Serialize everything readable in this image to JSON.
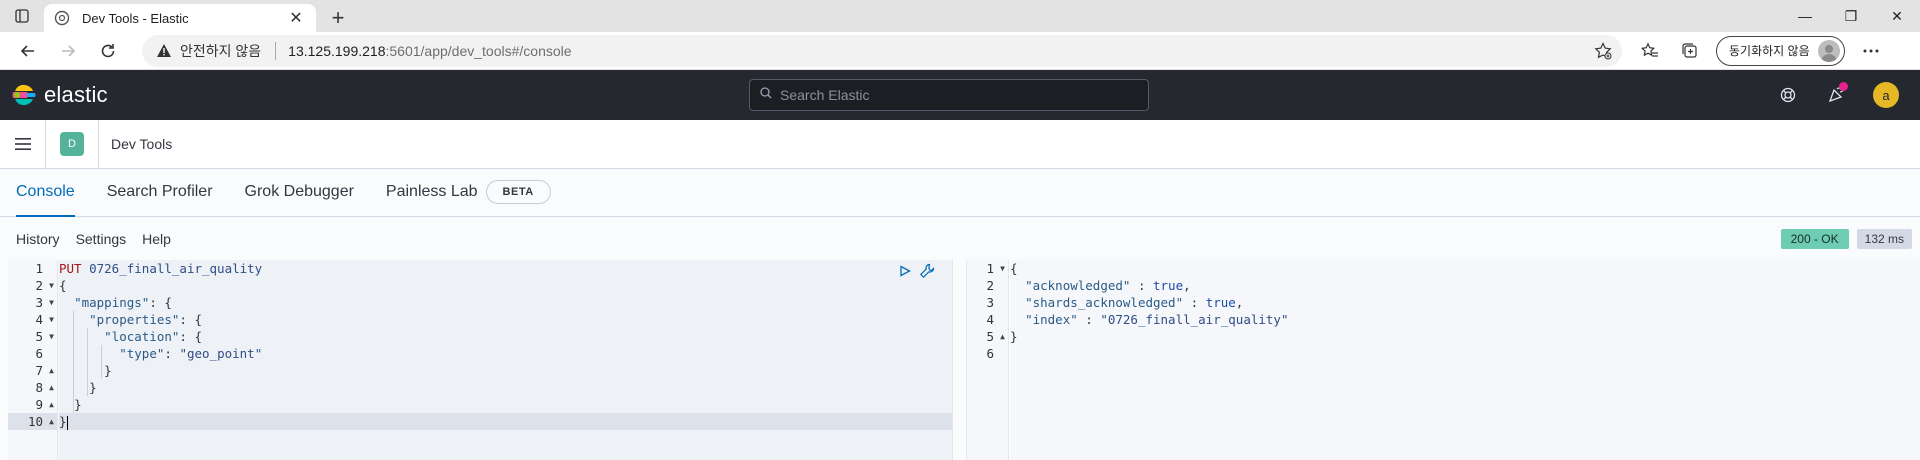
{
  "browser": {
    "tab_title": "Dev Tools - Elastic",
    "insecure_label": "안전하지 않음",
    "url_host": "13.125.199.218",
    "url_path": ":5601/app/dev_tools#/console",
    "sync_label": "동기화하지 않음"
  },
  "header": {
    "logo_text": "elastic",
    "search_placeholder": "Search Elastic",
    "user_initial": "a",
    "notification_color": "#e7228f"
  },
  "breadcrumb": {
    "space_initial": "D",
    "title": "Dev Tools"
  },
  "devtools": {
    "tabs": [
      {
        "label": "Console",
        "active": true
      },
      {
        "label": "Search Profiler",
        "active": false
      },
      {
        "label": "Grok Debugger",
        "active": false
      },
      {
        "label": "Painless Lab",
        "active": false
      }
    ],
    "beta_label": "BETA",
    "menu": {
      "history": "History",
      "settings": "Settings",
      "help": "Help"
    },
    "status": {
      "code": "200 - OK",
      "time": "132 ms",
      "ok_color": "#6dccb1"
    }
  },
  "request_editor": {
    "line_numbers": [
      "1",
      "2",
      "3",
      "4",
      "5",
      "6",
      "7",
      "8",
      "9",
      "10"
    ],
    "method": "PUT",
    "endpoint": "0726_finall_air_quality",
    "open_brace": "{",
    "mappings_key": "\"mappings\"",
    "properties_key": "\"properties\"",
    "location_key": "\"location\"",
    "type_key": "\"type\"",
    "type_value": "\"geo_point\"",
    "close_brace": "}"
  },
  "response_editor": {
    "line_numbers": [
      "1",
      "2",
      "3",
      "4",
      "5",
      "6"
    ],
    "open_brace": "{",
    "acknowledged_key": "\"acknowledged\"",
    "acknowledged_value": "true",
    "shards_key": "\"shards_acknowledged\"",
    "shards_value": "true",
    "index_key": "\"index\"",
    "index_value": "\"0726_finall_air_quality\"",
    "close_brace": "}"
  }
}
